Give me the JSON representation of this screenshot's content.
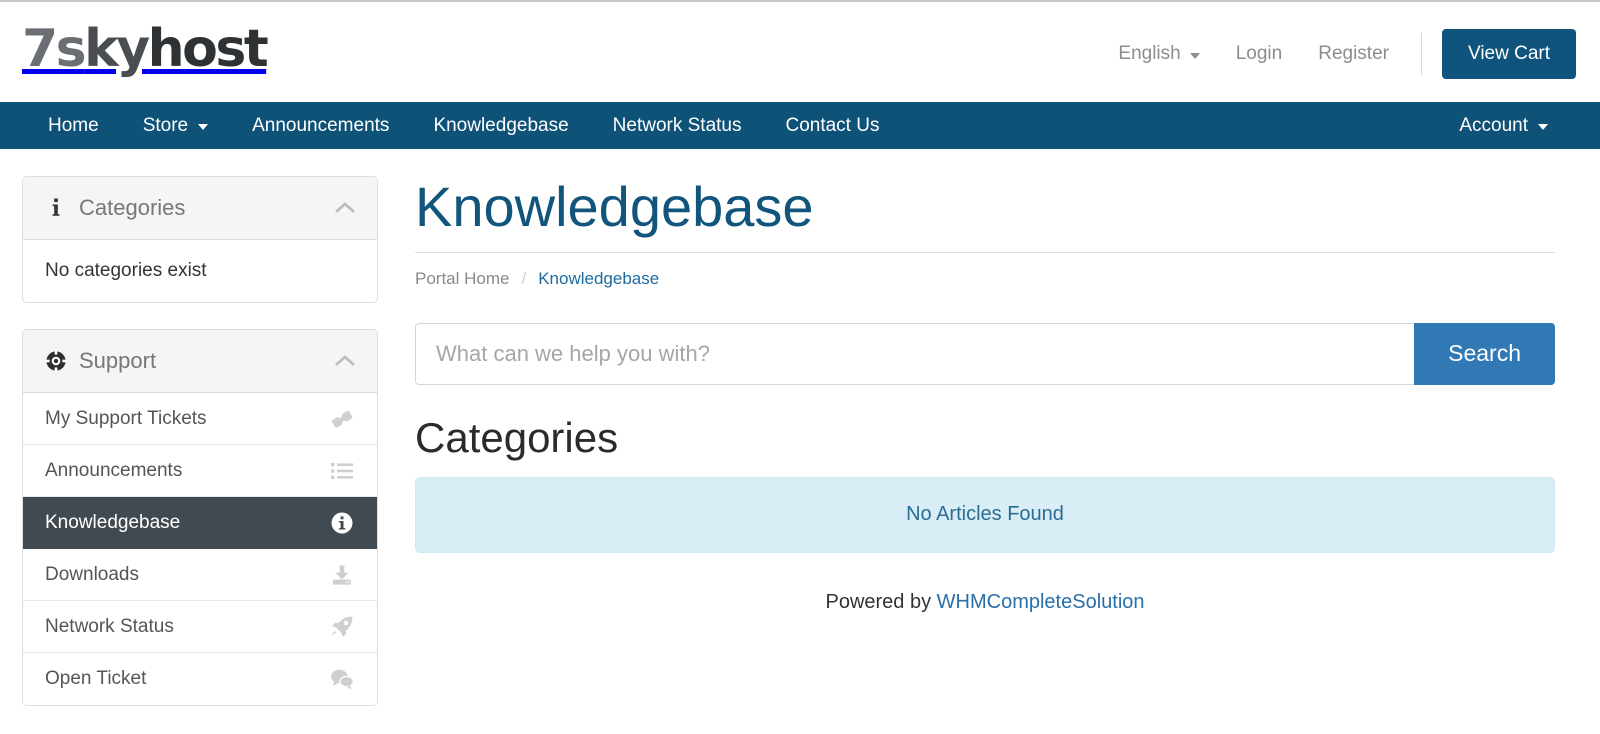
{
  "brand": {
    "logo_text": "7skyhost",
    "logo_part_1": "7s",
    "logo_part_2": "ky",
    "logo_part_3": "host"
  },
  "header": {
    "language": "English",
    "language_icon": "caret-down-icon",
    "login": "Login",
    "register": "Register",
    "view_cart": "View Cart"
  },
  "nav": {
    "items": [
      {
        "label": "Home",
        "has_caret": false
      },
      {
        "label": "Store",
        "has_caret": true
      },
      {
        "label": "Announcements",
        "has_caret": false
      },
      {
        "label": "Knowledgebase",
        "has_caret": false
      },
      {
        "label": "Network Status",
        "has_caret": false
      },
      {
        "label": "Contact Us",
        "has_caret": false
      }
    ],
    "account": "Account",
    "account_icon": "caret-down-icon"
  },
  "sidebar": {
    "categories_panel": {
      "title": "Categories",
      "icon": "info-icon",
      "collapse_icon": "chevron-up-icon",
      "empty_text": "No categories exist"
    },
    "support_panel": {
      "title": "Support",
      "icon": "lifebuoy-icon",
      "collapse_icon": "chevron-up-icon",
      "items": [
        {
          "label": "My Support Tickets",
          "icon": "ticket-icon",
          "active": false
        },
        {
          "label": "Announcements",
          "icon": "list-icon",
          "active": false
        },
        {
          "label": "Knowledgebase",
          "icon": "info-circle-icon",
          "active": true
        },
        {
          "label": "Downloads",
          "icon": "download-icon",
          "active": false
        },
        {
          "label": "Network Status",
          "icon": "rocket-icon",
          "active": false
        },
        {
          "label": "Open Ticket",
          "icon": "comments-icon",
          "active": false
        }
      ]
    }
  },
  "main": {
    "title": "Knowledgebase",
    "breadcrumb": {
      "home": "Portal Home",
      "separator": "/",
      "current": "Knowledgebase"
    },
    "search": {
      "placeholder": "What can we help you with?",
      "value": "",
      "button_label": "Search"
    },
    "categories_heading": "Categories",
    "no_articles": "No Articles Found"
  },
  "footer": {
    "powered_prefix": "Powered by ",
    "powered_link": "WHMCompleteSolution"
  },
  "colors": {
    "navbar": "#0f5278",
    "cart_button": "#10547e",
    "search_button": "#3079b5",
    "title": "#11547c",
    "active_item": "#424a51",
    "alert_bg": "#d9edf7"
  }
}
